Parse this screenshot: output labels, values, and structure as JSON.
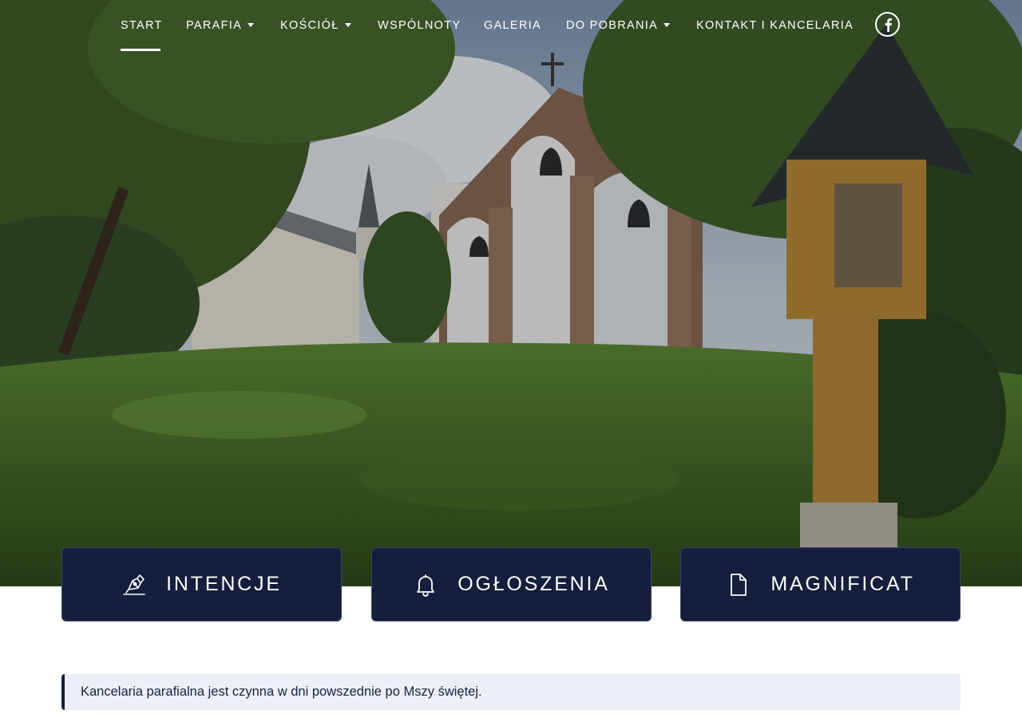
{
  "nav": {
    "items": [
      {
        "label": "START",
        "active": true,
        "dropdown": false
      },
      {
        "label": "PARAFIA",
        "active": false,
        "dropdown": true
      },
      {
        "label": "KOŚCIÓŁ",
        "active": false,
        "dropdown": true
      },
      {
        "label": "WSPÓLNOTY",
        "active": false,
        "dropdown": false
      },
      {
        "label": "GALERIA",
        "active": false,
        "dropdown": false
      },
      {
        "label": "DO POBRANIA",
        "active": false,
        "dropdown": true
      },
      {
        "label": "KONTAKT I KANCELARIA",
        "active": false,
        "dropdown": false
      }
    ],
    "social_icon": "facebook-icon"
  },
  "cards": [
    {
      "label": "INTENCJE",
      "icon": "pen-writing-icon"
    },
    {
      "label": "OGŁOSZENIA",
      "icon": "bell-icon"
    },
    {
      "label": "MAGNIFICAT",
      "icon": "document-icon"
    }
  ],
  "notice": {
    "text": "Kancelaria parafialna jest czynna w dni powszednie po Mszy świętej."
  },
  "colors": {
    "card_bg": "#151f3d",
    "notice_bg": "#ecf0f6",
    "notice_border": "#151f3d",
    "nav_text": "#ffffff"
  }
}
